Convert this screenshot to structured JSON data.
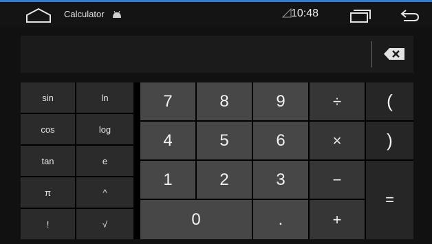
{
  "colors": {
    "accent_top_line": "#2f7bd6",
    "status_bg": "#141414",
    "display_bg": "#1b1b1b",
    "number_key": "#474747",
    "operator_key": "#363636",
    "advanced_key": "#2b2b2b",
    "paren_key": "#262626"
  },
  "status_bar": {
    "app_title": "Calculator",
    "time": "10:48",
    "icons": [
      "home-icon",
      "android-icon",
      "signal-icon",
      "recents-icon",
      "back-icon"
    ]
  },
  "display": {
    "value": "",
    "delete_icon": "backspace-icon"
  },
  "advanced_keys": [
    "sin",
    "ln",
    "cos",
    "log",
    "tan",
    "e",
    "π",
    "^",
    "!",
    "√"
  ],
  "number_keys": [
    "7",
    "8",
    "9",
    "4",
    "5",
    "6",
    "1",
    "2",
    "3",
    "0",
    "."
  ],
  "operator_keys": {
    "divide": "÷",
    "multiply": "×",
    "minus": "−",
    "plus": "+",
    "equals": "="
  },
  "paren_keys": {
    "open": "(",
    "close": ")"
  }
}
